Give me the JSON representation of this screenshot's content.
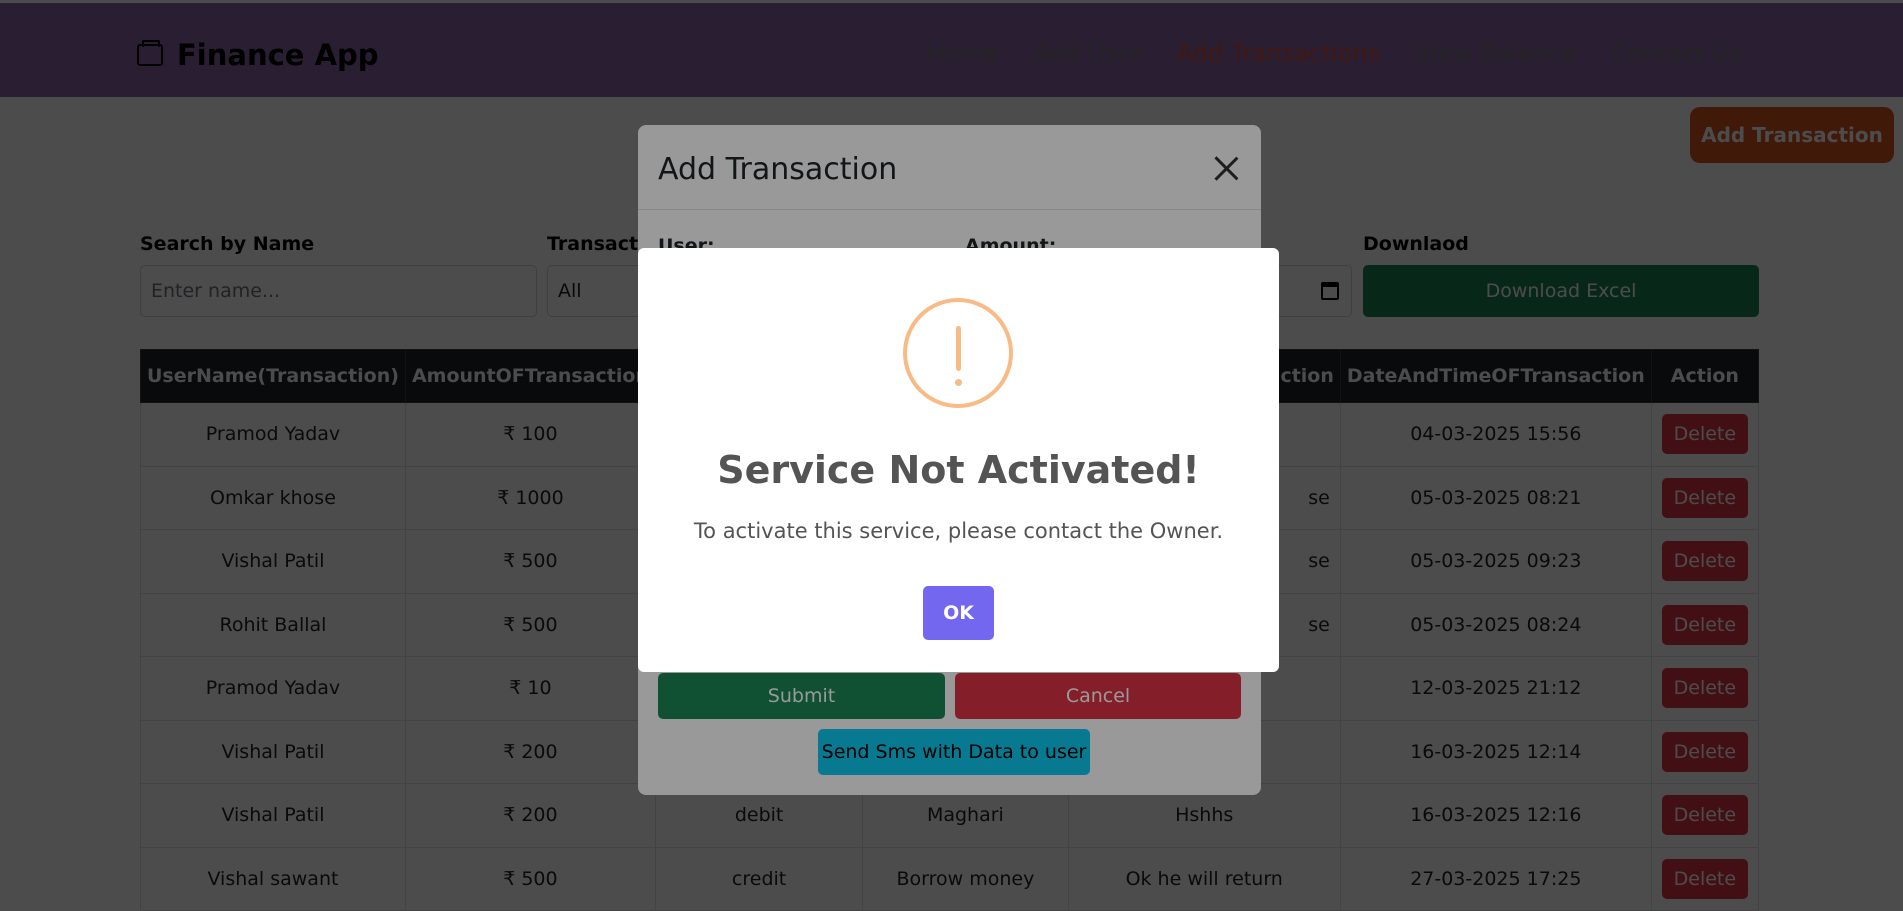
{
  "navbar": {
    "brand": "Finance App",
    "links": [
      "Home",
      "Add User",
      "Add Transactions",
      "View Balance",
      "Contact Us"
    ]
  },
  "add_transaction_button": "Add Transaction",
  "filters": {
    "search_label": "Search by Name",
    "search_placeholder": "Enter name...",
    "type_label": "Transactio",
    "type_value": "All",
    "download_label": "Downlaod",
    "download_button": "Download Excel"
  },
  "table": {
    "headers": [
      "UserName(Transaction)",
      "AmountOFTransaction",
      "",
      "",
      "ction",
      "DateAndTimeOFTransaction",
      "Action"
    ],
    "rows": [
      {
        "name": "Pramod Yadav",
        "amount": "₹ 100",
        "type": "",
        "reason": "",
        "desc": "",
        "date": "04-03-2025 15:56",
        "action": "Delete"
      },
      {
        "name": "Omkar khose",
        "amount": "₹ 1000",
        "type": "",
        "reason": "",
        "desc": "se",
        "date": "05-03-2025 08:21",
        "action": "Delete"
      },
      {
        "name": "Vishal Patil",
        "amount": "₹ 500",
        "type": "",
        "reason": "",
        "desc": "se",
        "date": "05-03-2025 09:23",
        "action": "Delete"
      },
      {
        "name": "Rohit Ballal",
        "amount": "₹ 500",
        "type": "",
        "reason": "",
        "desc": "se",
        "date": "05-03-2025 08:24",
        "action": "Delete"
      },
      {
        "name": "Pramod Yadav",
        "amount": "₹ 10",
        "type": "",
        "reason": "",
        "desc": "",
        "date": "12-03-2025 21:12",
        "action": "Delete"
      },
      {
        "name": "Vishal Patil",
        "amount": "₹ 200",
        "type": "",
        "reason": "",
        "desc": "",
        "date": "16-03-2025 12:14",
        "action": "Delete"
      },
      {
        "name": "Vishal Patil",
        "amount": "₹ 200",
        "type": "debit",
        "reason": "Maghari",
        "desc": "Hshhs",
        "date": "16-03-2025 12:16",
        "action": "Delete"
      },
      {
        "name": "Vishal sawant",
        "amount": "₹ 500",
        "type": "credit",
        "reason": "Borrow money",
        "desc": "Ok he will return",
        "date": "27-03-2025 17:25",
        "action": "Delete"
      }
    ]
  },
  "modal": {
    "title": "Add Transaction",
    "user_label": "User:",
    "amount_label": "Amount:",
    "submit": "Submit",
    "cancel": "Cancel",
    "sms": "Send Sms with Data to user"
  },
  "alert": {
    "title": "Service Not Activated!",
    "text": "To activate this service, please contact the Owner.",
    "ok": "OK"
  },
  "colors": {
    "navbar": "#8e66a8",
    "active_link": "#d9503a",
    "accent_button": "#d8541f",
    "success": "#198754",
    "danger": "#dc3545",
    "info": "#0dcaf0",
    "confirm": "#7367f0",
    "warning_icon": "#f8bb86"
  }
}
